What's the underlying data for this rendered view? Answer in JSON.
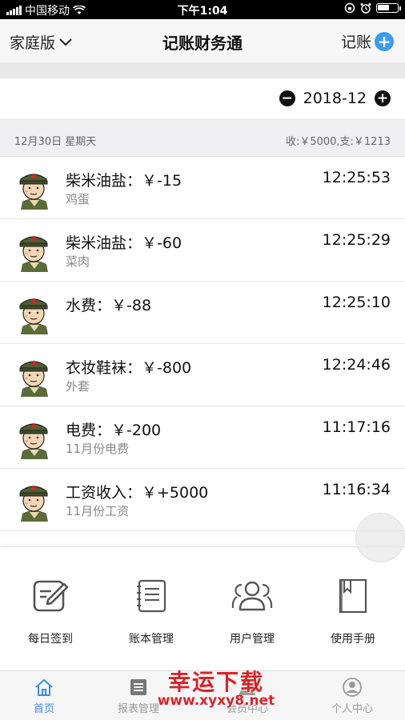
{
  "status_bar": {
    "carrier": "中国移动",
    "time": "下午1:04"
  },
  "nav": {
    "left_label": "家庭版",
    "title": "记账财务通",
    "right_label": "记账"
  },
  "month_bar": {
    "month": "2018-12"
  },
  "date_header": {
    "date": "12月30日  星期天",
    "summary": "收:￥5000,支:￥1213"
  },
  "records": [
    {
      "title": "柴米油盐：￥-15",
      "note": "鸡蛋",
      "time": "12:25:53"
    },
    {
      "title": "柴米油盐：￥-60",
      "note": "菜肉",
      "time": "12:25:29"
    },
    {
      "title": "水费：￥-88",
      "note": "",
      "time": "12:25:10"
    },
    {
      "title": "衣妆鞋袜：￥-800",
      "note": "外套",
      "time": "12:24:46"
    },
    {
      "title": "电费：￥-200",
      "note": "11月份电费",
      "time": "11:17:16"
    },
    {
      "title": "工资收入：￥+5000",
      "note": "11月份工资",
      "time": "11:16:34"
    }
  ],
  "panel": {
    "items": [
      {
        "label": "每日签到",
        "icon": "edit-icon"
      },
      {
        "label": "账本管理",
        "icon": "notebook-icon"
      },
      {
        "label": "用户管理",
        "icon": "users-icon"
      },
      {
        "label": "使用手册",
        "icon": "book-icon"
      }
    ]
  },
  "tabs": [
    {
      "label": "首页",
      "icon": "home-icon",
      "active": true
    },
    {
      "label": "报表管理",
      "icon": "report-icon",
      "active": false
    },
    {
      "label": "会员中心",
      "icon": "member-icon",
      "active": false
    },
    {
      "label": "个人中心",
      "icon": "person-icon",
      "active": false
    }
  ],
  "watermark": {
    "title": "幸运下载",
    "url": "www.xyxy8.net"
  },
  "colors": {
    "accent": "#3b9bf0",
    "tab_active": "#3a8ee6",
    "watermark": "#d8232a"
  }
}
